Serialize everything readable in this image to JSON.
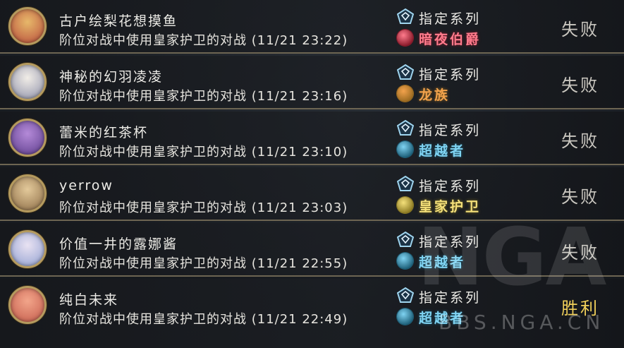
{
  "matches": [
    {
      "opponent": "古户绘梨花想摸鱼",
      "description": "阶位对战中使用皇家护卫的对战 (11/21 23:22)",
      "format_icon": "rotation-format-icon",
      "format": "指定系列",
      "class_icon": "abysscraft-icon",
      "opponent_class": "暗夜伯爵",
      "class_color": "#ff7b8c",
      "class_icon_color": "#8a1a2a",
      "result": "失败",
      "result_color": "#c9c6bf",
      "avatar_colors": [
        "#e7b86a",
        "#b64a3a"
      ]
    },
    {
      "opponent": "神秘的幻羽凌凌",
      "description": "阶位对战中使用皇家护卫的对战 (11/21 23:16)",
      "format_icon": "rotation-format-icon",
      "format": "指定系列",
      "class_icon": "dragoncraft-icon",
      "opponent_class": "龙族",
      "class_color": "#f2a24c",
      "class_icon_color": "#9a6a20",
      "result": "失败",
      "result_color": "#c9c6bf",
      "avatar_colors": [
        "#f1ede7",
        "#8c8fa8"
      ]
    },
    {
      "opponent": "蕾米的红茶杯",
      "description": "阶位对战中使用皇家护卫的对战 (11/21 23:10)",
      "format_icon": "rotation-format-icon",
      "format": "指定系列",
      "class_icon": "portalcraft-icon",
      "opponent_class": "超越者",
      "class_color": "#7fd3f2",
      "class_icon_color": "#1d5f78",
      "result": "失败",
      "result_color": "#c9c6bf",
      "avatar_colors": [
        "#b48ad8",
        "#5b3b8a"
      ]
    },
    {
      "opponent": "yerrow",
      "description": "阶位对战中使用皇家护卫的对战 (11/21 23:03)",
      "format_icon": "rotation-format-icon",
      "format": "指定系列",
      "class_icon": "havencraft-icon",
      "opponent_class": "皇家护卫",
      "class_color": "#f4e07a",
      "class_icon_color": "#8c7a22",
      "result": "失败",
      "result_color": "#c9c6bf",
      "avatar_colors": [
        "#e3c99a",
        "#8a6a44"
      ]
    },
    {
      "opponent": "价值一井的露娜酱",
      "description": "阶位对战中使用皇家护卫的对战 (11/21 22:55)",
      "format_icon": "rotation-format-icon",
      "format": "指定系列",
      "class_icon": "portalcraft-icon",
      "opponent_class": "超越者",
      "class_color": "#7fd3f2",
      "class_icon_color": "#1d5f78",
      "result": "失败",
      "result_color": "#c9c6bf",
      "avatar_colors": [
        "#e9e2f2",
        "#8f9fd0"
      ]
    },
    {
      "opponent": "纯白未来",
      "description": "阶位对战中使用皇家护卫的对战 (11/21 22:49)",
      "format_icon": "rotation-format-icon",
      "format": "指定系列",
      "class_icon": "portalcraft-icon",
      "opponent_class": "超越者",
      "class_color": "#7fd3f2",
      "class_icon_color": "#1d5f78",
      "result": "胜利",
      "result_color": "#f0cf5a",
      "avatar_colors": [
        "#f2a58a",
        "#c35a4a"
      ]
    }
  ],
  "watermark": {
    "logo": "NGA",
    "url": "BBS.NGA.CN"
  }
}
